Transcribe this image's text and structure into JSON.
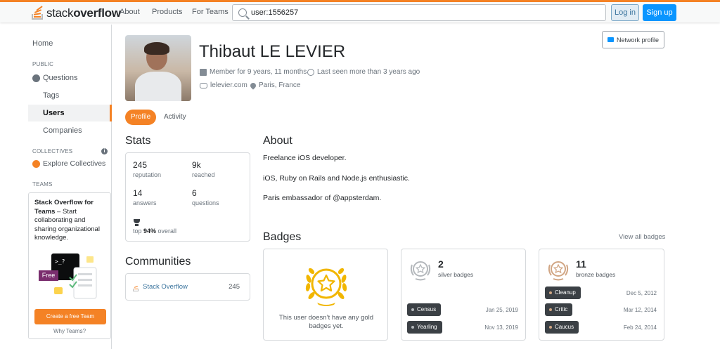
{
  "header": {
    "logo_regular": "stack",
    "logo_bold": "overflow",
    "nav": [
      "About",
      "Products",
      "For Teams"
    ],
    "search_value": "user:1556257",
    "login_label": "Log in",
    "signup_label": "Sign up"
  },
  "sidebar": {
    "home": "Home",
    "public_label": "PUBLIC",
    "questions": "Questions",
    "tags": "Tags",
    "users": "Users",
    "companies": "Companies",
    "collectives_label": "COLLECTIVES",
    "explore_collectives": "Explore Collectives",
    "teams_label": "TEAMS",
    "teams_title": "Stack Overflow for Teams",
    "teams_desc": " – Start collaborating and sharing organizational knowledge.",
    "free_badge": "Free",
    "cta": "Create a free Team",
    "why": "Why Teams?"
  },
  "profile": {
    "name": "Thibaut LE LEVIER",
    "member_for": "Member for 9 years, 11 months",
    "last_seen": "Last seen more than 3 years ago",
    "website": "lelevier.com",
    "location": "Paris, France",
    "network_profile": "Network profile",
    "tabs": [
      "Profile",
      "Activity"
    ]
  },
  "stats": {
    "title": "Stats",
    "reputation": {
      "value": "245",
      "label": "reputation"
    },
    "reached": {
      "value": "9k",
      "label": "reached"
    },
    "answers": {
      "value": "14",
      "label": "answers"
    },
    "questions": {
      "value": "6",
      "label": "questions"
    },
    "top_prefix": "top ",
    "top_percent": "94%",
    "top_suffix": " overall"
  },
  "communities": {
    "title": "Communities",
    "items": [
      {
        "name": "Stack Overflow",
        "rep": "245"
      }
    ]
  },
  "about": {
    "title": "About",
    "lines": [
      "Freelance iOS developer.",
      "iOS, Ruby on Rails and Node.js enthusiastic.",
      "Paris embassador of @appsterdam."
    ]
  },
  "badges": {
    "title": "Badges",
    "view_all": "View all badges",
    "gold_empty": "This user doesn’t have any gold badges yet.",
    "silver": {
      "count": "2",
      "label": "silver badges",
      "items": [
        {
          "name": "Census",
          "date": "Jan 25, 2019"
        },
        {
          "name": "Yearling",
          "date": "Nov 13, 2019"
        }
      ]
    },
    "bronze": {
      "count": "11",
      "label": "bronze badges",
      "items": [
        {
          "name": "Cleanup",
          "date": "Dec 5, 2012"
        },
        {
          "name": "Critic",
          "date": "Mar 12, 2014"
        },
        {
          "name": "Caucus",
          "date": "Feb 24, 2014"
        }
      ]
    }
  },
  "colors": {
    "accent": "#f48225",
    "link": "#39739d",
    "primary_button": "#0a95ff",
    "gold": "#f1b600",
    "silver": "#b4b8bc",
    "bronze": "#d1a684"
  }
}
